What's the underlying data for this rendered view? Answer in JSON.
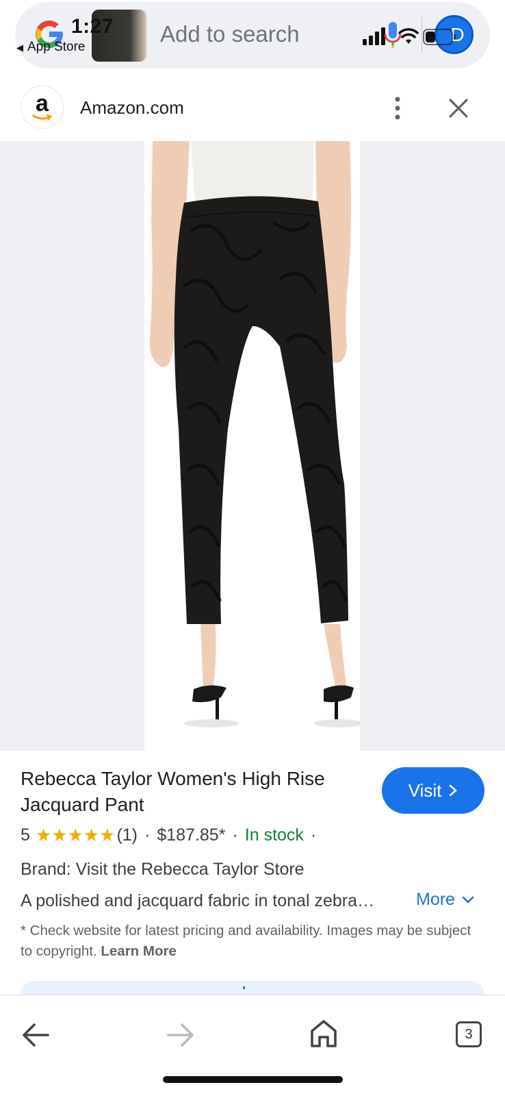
{
  "status_bar": {
    "time": "1:27",
    "back_app": "App Store"
  },
  "search": {
    "placeholder": "Add to search",
    "avatar_letter": "D"
  },
  "site": {
    "name": "Amazon.com",
    "logo_letter": "a"
  },
  "product": {
    "title": "Rebecca Taylor Women's High Rise Jacquard Pant",
    "visit_label": "Visit",
    "rating_value": "5",
    "rating_stars": 5,
    "stars_glyph": "★★★★★",
    "review_count": "(1)",
    "price": "$187.85*",
    "stock": "In stock",
    "separator": "·",
    "brand": "Brand: Visit the Rebecca Taylor Store",
    "description": "A polished and jacquard fabric in tonal zebra…",
    "more_label": "More",
    "disclaimer": "* Check website for latest pricing and availability. Images may be subject to copyright.",
    "learn_more": "Learn More"
  },
  "bottom_nav": {
    "tab_count": "3"
  },
  "colors": {
    "accent": "#1a73e8",
    "in_stock": "#188038",
    "star": "#f9ab00",
    "image_bg": "#eef0f3"
  },
  "icons": [
    "google-logo-icon",
    "signal-icon",
    "mic-icon",
    "wifi-icon",
    "battery-icon",
    "kebab-menu-icon",
    "close-icon",
    "chevron-right-icon",
    "chevron-down-icon",
    "back-arrow-icon",
    "forward-arrow-icon",
    "home-icon",
    "tabs-icon"
  ]
}
